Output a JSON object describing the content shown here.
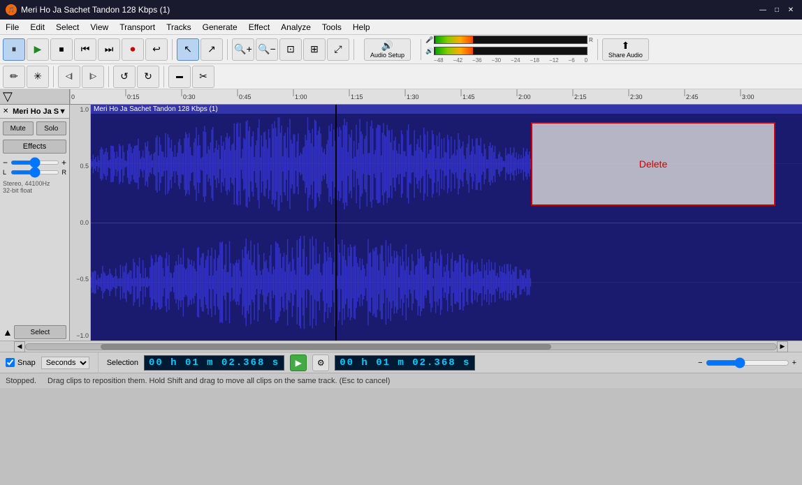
{
  "titlebar": {
    "title": "Meri Ho Ja Sachet Tandon 128 Kbps (1)",
    "icon": "🎵",
    "min": "—",
    "max": "□",
    "close": "✕"
  },
  "menu": {
    "items": [
      "File",
      "Edit",
      "Select",
      "View",
      "Transport",
      "Tracks",
      "Generate",
      "Effect",
      "Analyze",
      "Tools",
      "Help"
    ]
  },
  "toolbar": {
    "play_label": "▶",
    "pause_label": "⏸",
    "stop_label": "⏹",
    "back_label": "⏮",
    "forward_label": "⏭",
    "record_label": "⏺",
    "loop_label": "↩",
    "audio_setup": "Audio Setup",
    "share_audio": "Share Audio",
    "cursor_tool": "↖",
    "select_tool": "I",
    "zoom_in": "+",
    "zoom_out": "−",
    "fit_track": "⊡",
    "fit_project": "⊞",
    "draw_tool": "✏",
    "multi_tool": "✳",
    "trim_left": "◁|",
    "trim_right": "|▷",
    "undo": "↺",
    "redo": "↻",
    "silence": "◼",
    "cut_preview": "✂"
  },
  "track": {
    "name": "Meri Ho Ja S▼",
    "full_name": "Meri Ho Ja Sachet Tandon 128 Kbps (1)",
    "mute": "Mute",
    "solo": "Solo",
    "effects": "Effects",
    "gain_left": "−",
    "gain_right": "+",
    "pan_left": "L",
    "pan_right": "R",
    "info": "Stereo, 44100Hz",
    "info2": "32-bit float",
    "select": "Select",
    "collapse": "▲",
    "y_labels": [
      "1.0",
      "0.5",
      "0.0",
      "−0.5",
      "−1.0"
    ],
    "y_labels2": [
      "0.5",
      "0.0",
      "−0.5",
      "−1.0"
    ],
    "delete_label": "Delete"
  },
  "ruler": {
    "ticks": [
      "0",
      "0:15",
      "0:30",
      "0:45",
      "1:00",
      "1:15",
      "1:30",
      "1:45",
      "2:00",
      "2:15",
      "2:30",
      "2:45",
      "3:00"
    ]
  },
  "status": {
    "stopped": "Stopped.",
    "drag_hint": "Drag clips to reposition them. Hold Shift and drag to move all clips on the same track. (Esc to cancel)"
  },
  "selection": {
    "snap_label": "Snap",
    "seconds_label": "Seconds",
    "selection_label": "Selection",
    "time1": "00 h 01 m 02.368 s",
    "time2": "00 h 01 m 02.368 s",
    "settings_icon": "⚙"
  },
  "playback": {
    "play_btn": "▶"
  },
  "colors": {
    "waveform": "#3333cc",
    "background": "#1a1a6e",
    "delete_border": "#cc0000",
    "delete_text": "#cc0000",
    "accent": "#0078d7"
  }
}
